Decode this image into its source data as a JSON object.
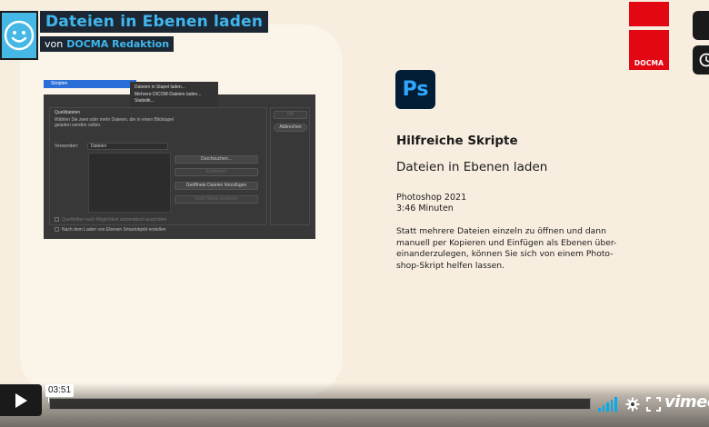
{
  "player": {
    "title": "Dateien in Ebenen laden",
    "byline_prefix": "von",
    "author": "DOCMA Redaktion",
    "timecode": "03:51",
    "brand": "vimeo",
    "accent_color": "#00adef",
    "played_fraction": 0.0
  },
  "photoshop_dialog": {
    "menu_item": "Skripten",
    "submenu": [
      "Dateien in Stapel laden...",
      "Mehrere DICOM-Dateien laden...",
      "Statistik..."
    ],
    "group_title": "Quelldateien",
    "instruction_line1": "Wählen Sie zwei oder mehr Dateien, die in einen Bildstapel",
    "instruction_line2": "geladen werden sollen.",
    "use_label": "Verwenden:",
    "use_value": "Dateien",
    "buttons": {
      "browse": "Durchsuchen...",
      "remove": "Entfernen",
      "add_open": "Geöffnete Dateien hinzufügen",
      "sort": "Nach Name sortieren",
      "ok": "OK",
      "cancel": "Abbrechen"
    },
    "checkbox_align": "Quellbilder nach Möglichkeit automatisch ausrichten",
    "checkbox_smart": "Nach dem Laden von Ebenen Smartobjekt erstellen"
  },
  "info": {
    "app_icon_text": "Ps",
    "heading": "Hilfreiche Skripte",
    "subheading": "Dateien in Ebenen laden",
    "version": "Photoshop 2021",
    "duration": "3:46 Minuten",
    "description_lines": [
      "Statt mehrere Dateien einzeln zu öffnen und dann",
      "manuell per Kopieren und Einfügen als Ebenen über-",
      "einanderzulegen, können Sie sich von einem Photo-",
      "shop-Skript helfen lassen."
    ]
  },
  "logo": {
    "text": "DOCMA",
    "color": "#e30613"
  },
  "icons": [
    "smiley-avatar-icon",
    "clock-icon",
    "play-icon",
    "volume-icon",
    "gear-icon",
    "fullscreen-icon"
  ]
}
